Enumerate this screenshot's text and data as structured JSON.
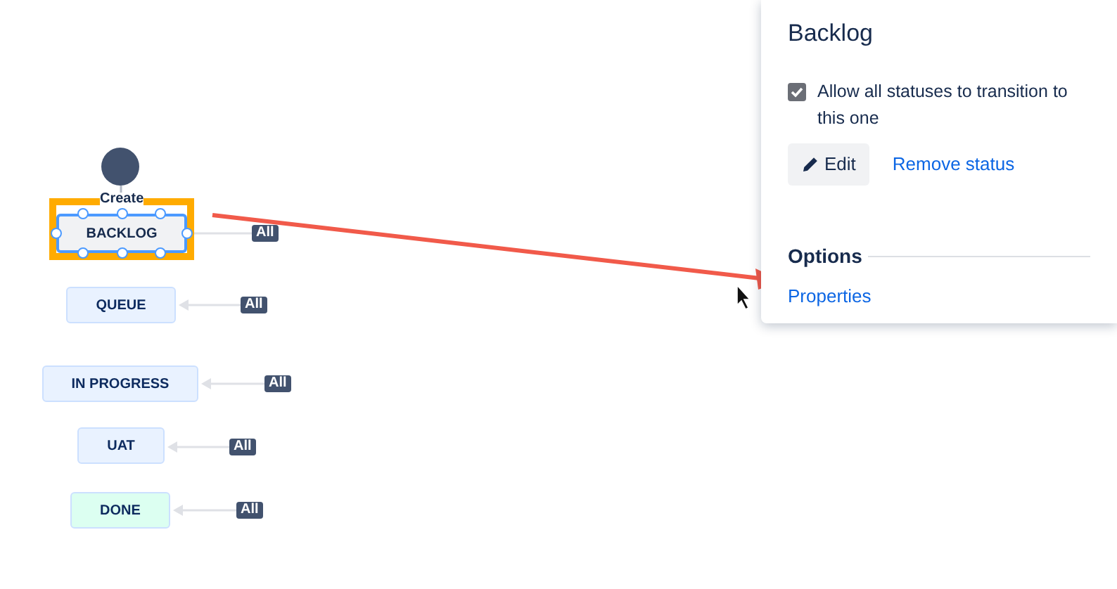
{
  "diagram": {
    "start": {
      "label": "Create"
    },
    "statuses": [
      {
        "label": "BACKLOG",
        "color": "#f1f2f4",
        "selected": true,
        "transition": "All"
      },
      {
        "label": "QUEUE",
        "color": "#e9f2ff",
        "selected": false,
        "transition": "All"
      },
      {
        "label": "IN PROGRESS",
        "color": "#e9f2ff",
        "selected": false,
        "transition": "All"
      },
      {
        "label": "UAT",
        "color": "#e9f2ff",
        "selected": false,
        "transition": "All"
      },
      {
        "label": "DONE",
        "color": "#dcfff1",
        "selected": false,
        "transition": "All"
      }
    ]
  },
  "panel": {
    "title": "Backlog",
    "allow_all": {
      "label": "Allow all statuses to transition to this one",
      "checked": true
    },
    "edit_button": "Edit",
    "remove_link": "Remove status",
    "options_heading": "Options",
    "properties_link": "Properties"
  }
}
